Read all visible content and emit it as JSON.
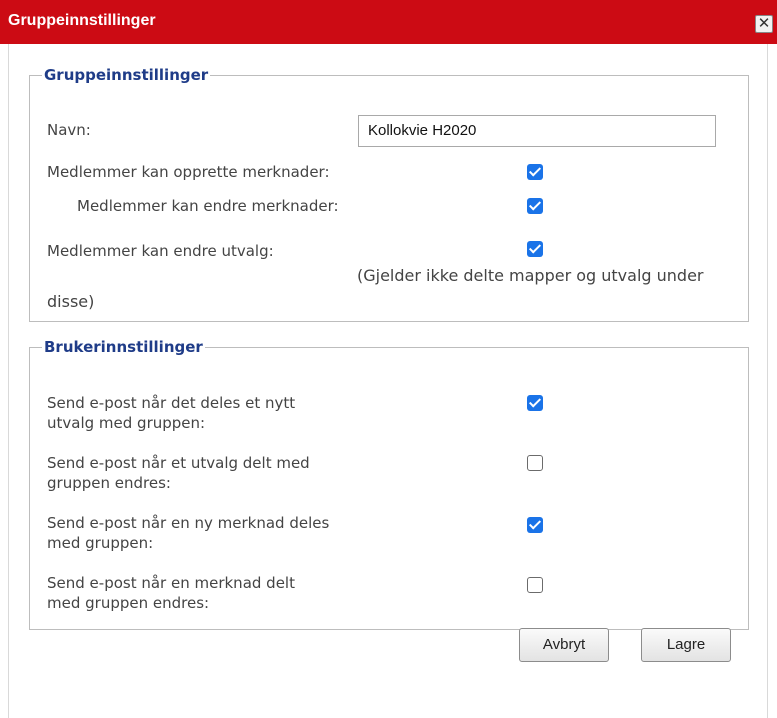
{
  "dialog": {
    "title": "Gruppeinnstillinger",
    "close_symbol": "✕"
  },
  "group_settings": {
    "legend": "Gruppeinnstillinger",
    "name_label": "Navn:",
    "name_value": "Kollokvie H2020",
    "create_notes_label": "Medlemmer kan opprette merknader:",
    "create_notes_checked": true,
    "edit_notes_label": "Medlemmer kan endre merknader:",
    "edit_notes_checked": true,
    "edit_selections_label": "Medlemmer kan endre utvalg:",
    "edit_selections_checked": true,
    "note_line1": "(Gjelder ikke delte mapper og utvalg under",
    "note_line2": "disse)"
  },
  "user_settings": {
    "legend": "Brukerinnstillinger",
    "items": [
      {
        "line1": "Send e-post når det deles et nytt",
        "line2": "utvalg med gruppen:",
        "checked": true
      },
      {
        "line1": "Send e-post når et utvalg delt med",
        "line2": "gruppen endres:",
        "checked": false
      },
      {
        "line1": "Send e-post når en ny merknad deles",
        "line2": "med gruppen:",
        "checked": true
      },
      {
        "line1": "Send e-post når en merknad delt",
        "line2": "med gruppen endres:",
        "checked": false
      }
    ]
  },
  "buttons": {
    "cancel": "Avbryt",
    "save": "Lagre"
  },
  "colors": {
    "titlebar": "#cc0b14",
    "legend": "#1f3c88",
    "checkbox_checked": "#1a73e8"
  }
}
